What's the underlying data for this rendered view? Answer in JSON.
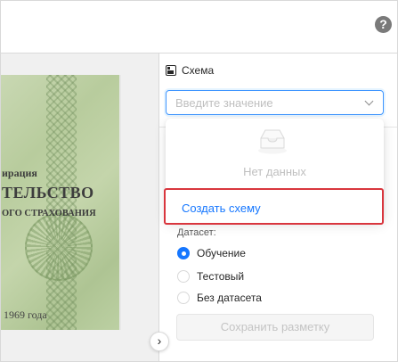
{
  "header": {
    "help_icon": "question-circle-icon",
    "help_glyph": "?"
  },
  "document": {
    "line1": "ирация",
    "line2": "ТЕЛЬСТВО",
    "line3": "ОГО СТРАХОВАНИЯ",
    "line4": "1969 года"
  },
  "schema": {
    "label": "Схема",
    "icon": "schema-icon",
    "placeholder": "Введите значение",
    "empty_text": "Нет данных",
    "create_link": "Создать схему"
  },
  "dataset": {
    "label": "Датасет:",
    "options": [
      {
        "label": "Обучение",
        "checked": true
      },
      {
        "label": "Тестовый",
        "checked": false
      },
      {
        "label": "Без датасета",
        "checked": false
      }
    ]
  },
  "actions": {
    "save_label": "Сохранить разметку",
    "collapse_glyph": "›"
  },
  "colors": {
    "accent": "#1677ff",
    "highlight": "#d9363e"
  }
}
